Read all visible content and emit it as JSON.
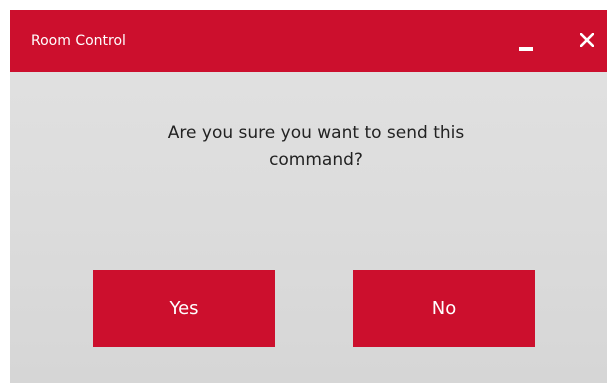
{
  "window": {
    "title": "Room Control",
    "minimize_icon": "minimize-icon",
    "close_icon": "close-icon"
  },
  "dialog": {
    "message": "Are you sure you want to send this command?"
  },
  "buttons": {
    "yes_label": "Yes",
    "no_label": "No"
  },
  "colors": {
    "accent": "#cc0f2d",
    "background": "#dcdcdc",
    "text": "#222222",
    "button_text": "#ffffff"
  }
}
